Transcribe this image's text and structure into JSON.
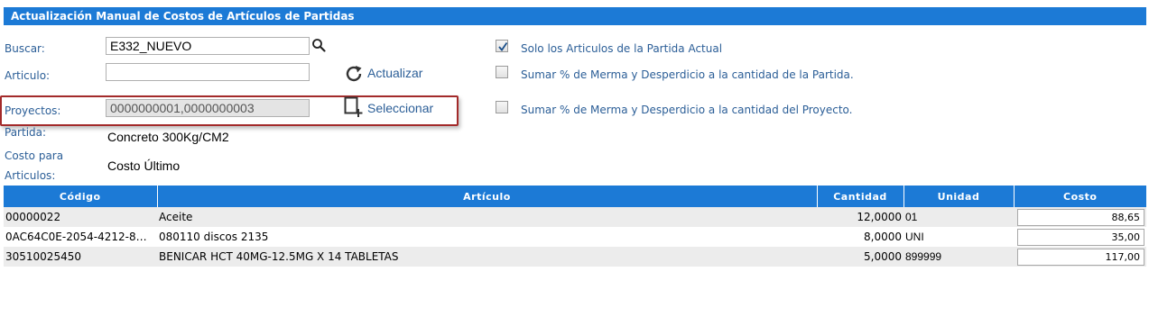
{
  "title": "Actualización Manual de Costos de Artículos de Partidas",
  "form": {
    "buscar_label": "Buscar:",
    "buscar_value": "E332_NUEVO",
    "articulo_label": "Articulo:",
    "articulo_value": "",
    "actualizar_label": "Actualizar",
    "proyectos_label": "Proyectos:",
    "proyectos_value": "0000000001,0000000003",
    "seleccionar_label": "Seleccionar",
    "partida_label": "Partida:",
    "partida_value": "Concreto 300Kg/CM2",
    "costo_label_line1": "Costo para",
    "costo_label_line2": "Articulos:",
    "costo_value": "Costo Último"
  },
  "options": [
    {
      "label": "Solo los Articulos de la Partida Actual",
      "checked": true
    },
    {
      "label": "Sumar % de Merma y Desperdicio a la cantidad de la Partida.",
      "checked": false
    },
    {
      "label": "Sumar % de Merma y Desperdicio a la cantidad del Proyecto.",
      "checked": false
    }
  ],
  "table": {
    "headers": {
      "codigo": "Código",
      "articulo": "Artículo",
      "cantidad": "Cantidad",
      "unidad": "Unidad",
      "costo": "Costo"
    },
    "rows": [
      {
        "codigo": "00000022",
        "articulo": "Aceite",
        "cantidad": "12,0000",
        "unidad": "01",
        "costo": "88,65"
      },
      {
        "codigo": "0AC64C0E-2054-4212-8…",
        "articulo": "080110 discos 2135",
        "cantidad": "8,0000",
        "unidad": "UNI",
        "costo": "35,00"
      },
      {
        "codigo": "30510025450",
        "articulo": "BENICAR HCT 40MG-12.5MG X 14 TABLETAS",
        "cantidad": "5,0000",
        "unidad": "899999",
        "costo": "117,00"
      }
    ]
  },
  "colors": {
    "accent": "#1c7ad6",
    "label": "#2b5e97",
    "highlight": "#a32a2a"
  },
  "icons": [
    "search-icon",
    "refresh-icon",
    "select-add-icon",
    "check-icon"
  ]
}
